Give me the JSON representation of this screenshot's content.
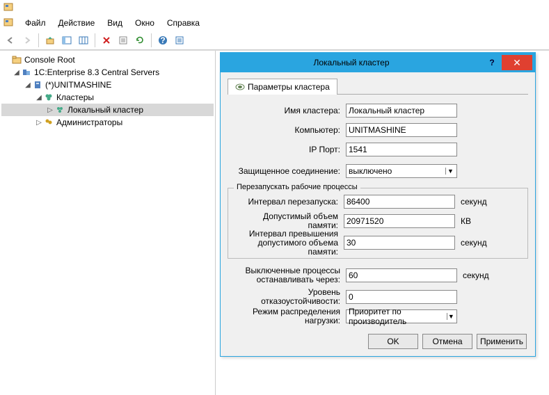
{
  "menubar": {
    "file": "Файл",
    "action": "Действие",
    "view": "Вид",
    "window": "Окно",
    "help": "Справка"
  },
  "tree": {
    "root": "Console Root",
    "central_servers": "1C:Enterprise 8.3 Central Servers",
    "server": "(*)UNITMASHINE",
    "clusters": "Кластеры",
    "local_cluster": "Локальный кластер",
    "administrators": "Администраторы"
  },
  "dialog": {
    "title": "Локальный кластер",
    "tab_params": "Параметры кластера",
    "labels": {
      "name": "Имя кластера:",
      "computer": "Компьютер:",
      "ip_port": "IP Порт:",
      "secure_conn": "Защищенное соединение:",
      "restart_legend": "Перезапускать рабочие процессы",
      "restart_interval": "Интервал перезапуска:",
      "allowed_mem": "Допустимый объем памяти:",
      "mem_exceed_interval": "Интервал превышения допустимого объема памяти:",
      "stop_disabled": "Выключенные процессы останавливать через:",
      "fault_tolerance": "Уровень отказоустойчивости:",
      "load_mode": "Режим распределения нагрузки:"
    },
    "values": {
      "name": "Локальный кластер",
      "computer": "UNITMASHINE",
      "ip_port": "1541",
      "secure_conn": "выключено",
      "restart_interval": "86400",
      "allowed_mem": "20971520",
      "mem_exceed_interval": "30",
      "stop_disabled": "60",
      "fault_tolerance": "0",
      "load_mode": "Приоритет по производитель"
    },
    "units": {
      "seconds": "секунд",
      "kb": "КВ"
    },
    "buttons": {
      "ok": "OK",
      "cancel": "Отмена",
      "apply": "Применить"
    }
  }
}
